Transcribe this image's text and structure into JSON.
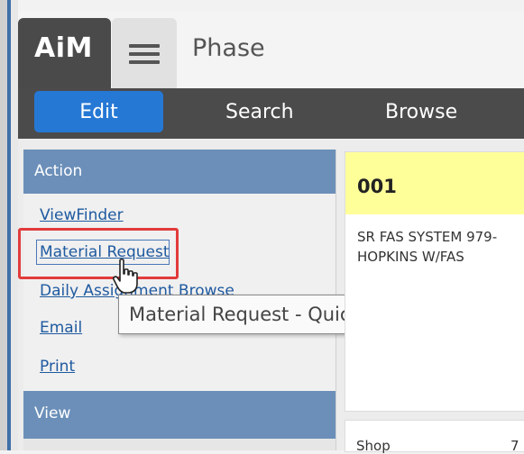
{
  "app": {
    "logo": "AiM",
    "page_title": "Phase"
  },
  "nav": {
    "edit": "Edit",
    "search": "Search",
    "browse": "Browse"
  },
  "panel": {
    "action_header": "Action",
    "action_links": [
      "ViewFinder",
      "Material Request",
      "Daily Assignment Browse",
      "Email",
      "Print"
    ],
    "view_header": "View"
  },
  "tooltip": "Material Request - Quick Key: B",
  "record": {
    "code": "001",
    "description_line1": "SR  FAS SYSTEM 979-",
    "description_line2": "HOPKINS W/FAS"
  },
  "detail": {
    "shop_label": "Shop",
    "shop_value": "7"
  },
  "icons": {
    "menu": "hamburger-menu-icon",
    "cursor": "hand-pointer-cursor-icon"
  },
  "colors": {
    "edit_button": "#2678d5",
    "panel_header": "#6b8fb9",
    "highlight": "#e23b3b",
    "record_header": "#ffff99"
  }
}
